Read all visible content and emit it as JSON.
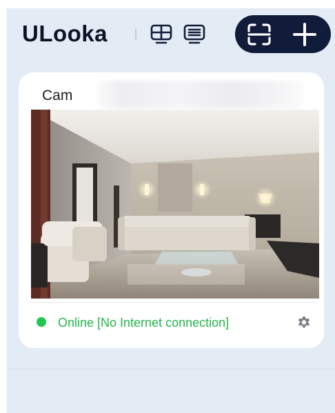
{
  "header": {
    "title": "ULooka",
    "icons": [
      "grid-view-icon",
      "list-view-icon"
    ],
    "actions": [
      "scan-icon",
      "plus-icon"
    ]
  },
  "device_card": {
    "name": "Cam",
    "status": "Online [No Internet connection]",
    "status_color": "#22b64b",
    "preview_icon": "gear-icon"
  },
  "colors": {
    "background": "#e3ebf4",
    "header_pill": "#111c3a",
    "title": "#0d1226",
    "card": "#ffffff",
    "online_dot": "#23c552"
  }
}
